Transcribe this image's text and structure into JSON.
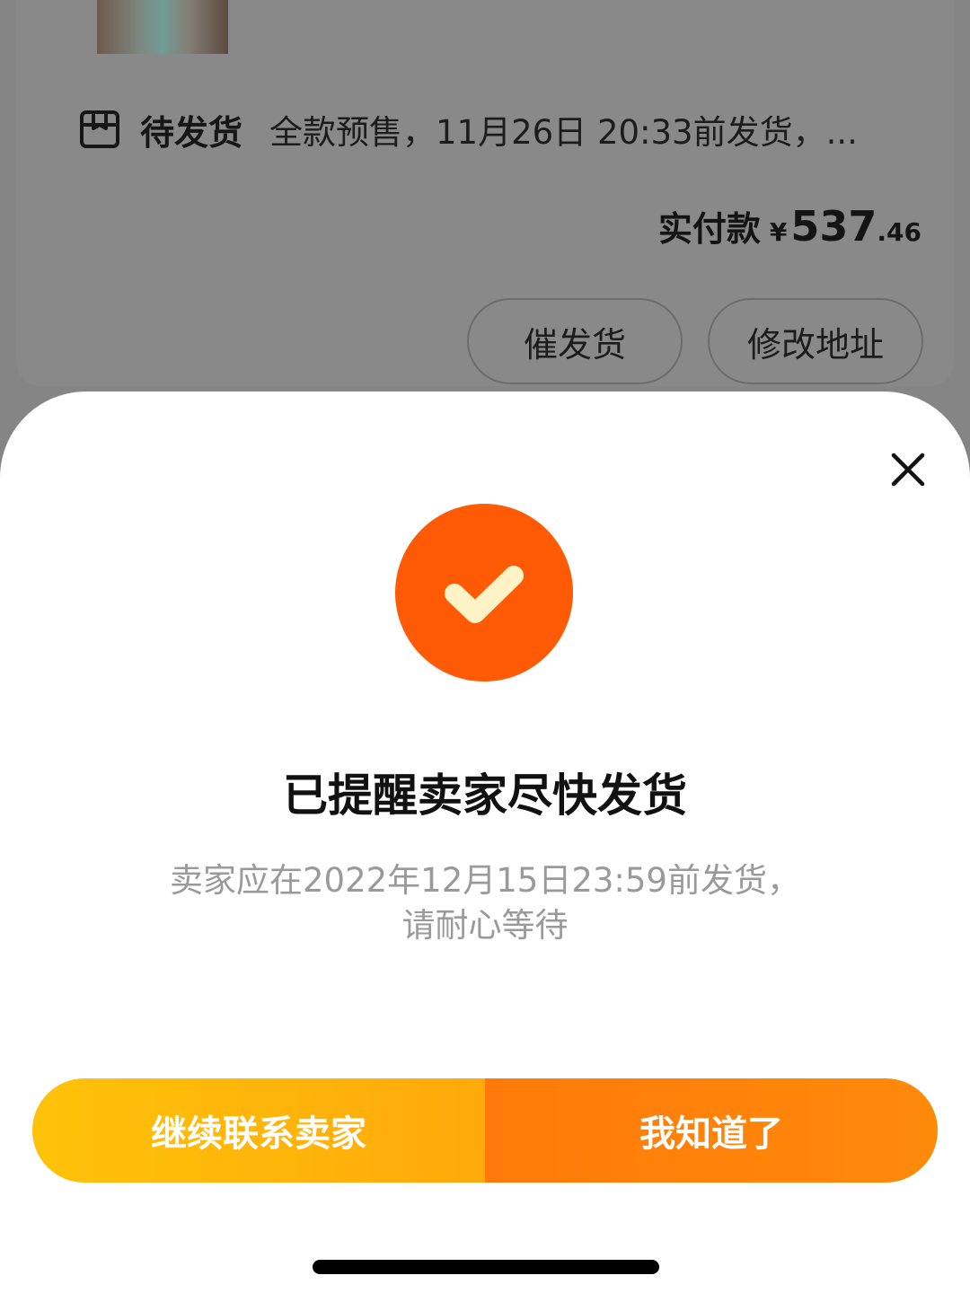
{
  "order": {
    "status_icon": "package-box-icon",
    "status_label": "待发货",
    "status_desc": "全款预售，11月26日 20:33前发货，...",
    "pay_label": "实付款",
    "pay_currency": "¥",
    "pay_integer": "537",
    "pay_decimal": ".46",
    "buttons": {
      "urge_label": "催发货",
      "address_label": "修改地址"
    }
  },
  "sheet": {
    "close_icon": "close-icon",
    "success_icon": "check-icon",
    "title": "已提醒卖家尽快发货",
    "subtitle_line1": "卖家应在2022年12月15日23:59前发货，",
    "subtitle_line2": "请耐心等待",
    "actions": {
      "continue_label": "继续联系卖家",
      "ok_label": "我知道了"
    }
  },
  "colors": {
    "success": "#ff5a05",
    "check": "#fff2c4",
    "button_left": "#ffb60a",
    "button_right": "#ff800a"
  }
}
